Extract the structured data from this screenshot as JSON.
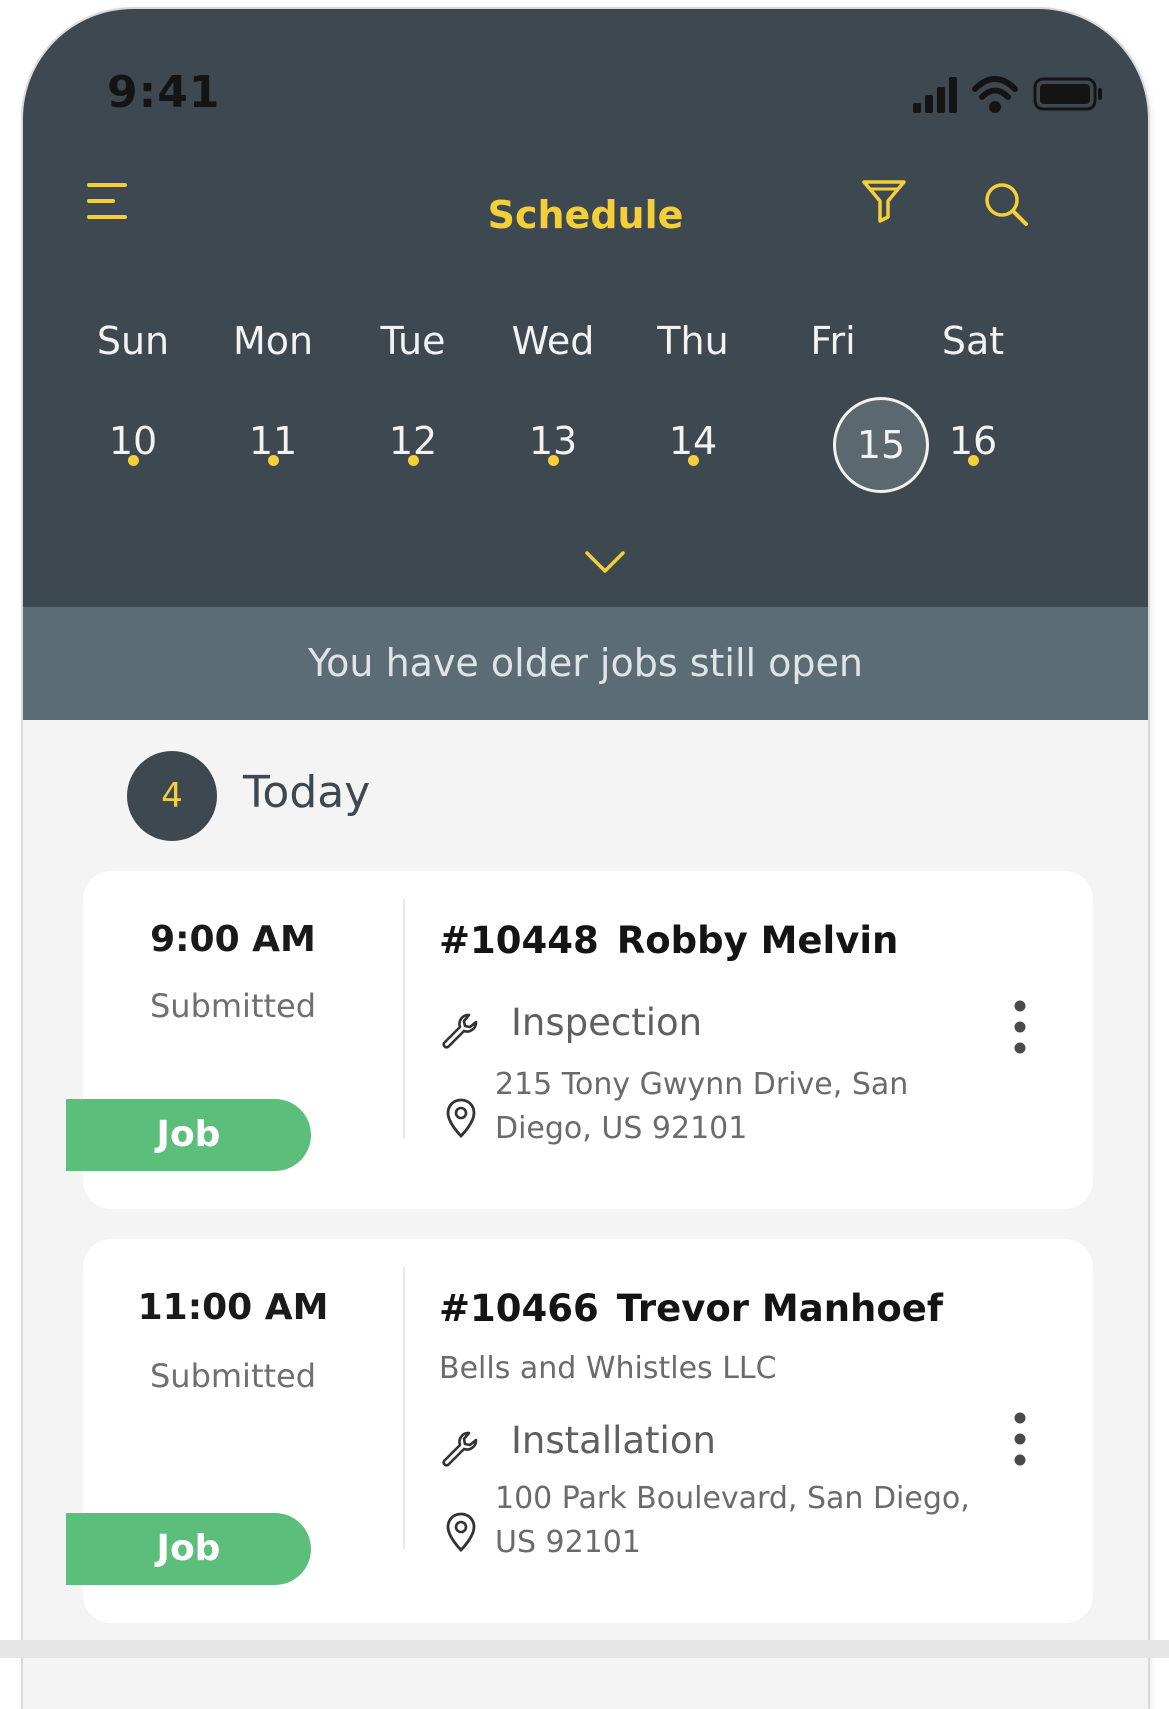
{
  "status_bar": {
    "time": "9:41"
  },
  "header": {
    "title": "Schedule"
  },
  "week": {
    "days": [
      "Sun",
      "Mon",
      "Tue",
      "Wed",
      "Thu",
      "Fri",
      "Sat"
    ],
    "dates": [
      "10",
      "11",
      "12",
      "13",
      "14",
      "15",
      "16"
    ],
    "selected_index": 5
  },
  "banner": {
    "text": "You have older jobs still open"
  },
  "section": {
    "count": "4",
    "title": "Today"
  },
  "jobs": [
    {
      "time": "9:00 AM",
      "status": "Submitted",
      "badge": "Job",
      "number": "#10448",
      "customer": "Robby Melvin",
      "company": "",
      "service": "Inspection",
      "address_line1": "215 Tony Gwynn Drive, San",
      "address_line2": "Diego, US 92101"
    },
    {
      "time": "11:00 AM",
      "status": "Submitted",
      "badge": "Job",
      "number": "#10466",
      "customer": "Trevor Manhoef",
      "company": "Bells and Whistles LLC",
      "service": "Installation",
      "address_line1": "100 Park Boulevard, San Diego,",
      "address_line2": "US 92101"
    }
  ],
  "colors": {
    "header_bg": "#3d4850",
    "accent": "#f5cf38",
    "banner_bg": "#5c6c75",
    "job_badge": "#5bbf7b"
  },
  "icons": {
    "menu": "menu-icon",
    "filter": "filter-icon",
    "search": "search-icon",
    "expand": "chevron-down-icon",
    "service": "wrench-icon",
    "location": "map-pin-icon",
    "more": "more-vertical-icon"
  }
}
